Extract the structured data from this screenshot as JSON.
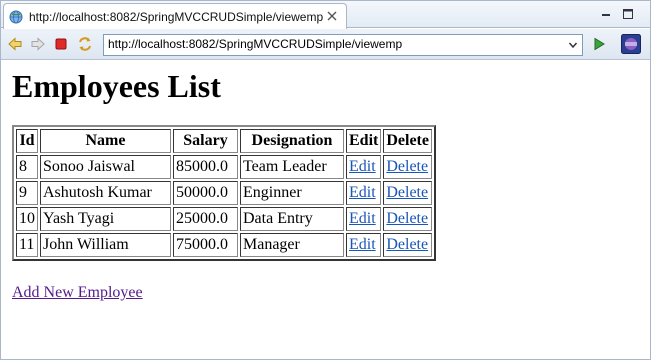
{
  "browser": {
    "tab_title": "http://localhost:8082/SpringMVCCRUDSimple/viewemp",
    "url": "http://localhost:8082/SpringMVCCRUDSimple/viewemp"
  },
  "page": {
    "title": "Employees List",
    "columns": [
      "Id",
      "Name",
      "Salary",
      "Designation",
      "Edit",
      "Delete"
    ],
    "rows": [
      {
        "id": "8",
        "name": "Sonoo Jaiswal",
        "salary": "85000.0",
        "designation": "Team Leader",
        "edit": "Edit",
        "delete": "Delete"
      },
      {
        "id": "9",
        "name": "Ashutosh Kumar",
        "salary": "50000.0",
        "designation": "Enginner",
        "edit": "Edit",
        "delete": "Delete"
      },
      {
        "id": "10",
        "name": "Yash Tyagi",
        "salary": "25000.0",
        "designation": "Data Entry",
        "edit": "Edit",
        "delete": "Delete"
      },
      {
        "id": "11",
        "name": "John William",
        "salary": "75000.0",
        "designation": "Manager",
        "edit": "Edit",
        "delete": "Delete"
      }
    ],
    "add_link": "Add New Employee"
  },
  "colors": {
    "link": "#1a55b8",
    "visited_link": "#551a8b",
    "chrome_border": "#a9b7c9"
  },
  "icons": {
    "tab": "globe-icon",
    "tab_close": "close-icon",
    "back": "back-arrow-icon",
    "forward": "forward-arrow-icon",
    "stop": "stop-icon",
    "refresh": "refresh-icon",
    "url_dropdown": "chevron-down-icon",
    "go": "go-play-icon",
    "browser_menu": "eclipse-icon",
    "minimize": "minimize-icon",
    "maximize": "maximize-icon"
  }
}
